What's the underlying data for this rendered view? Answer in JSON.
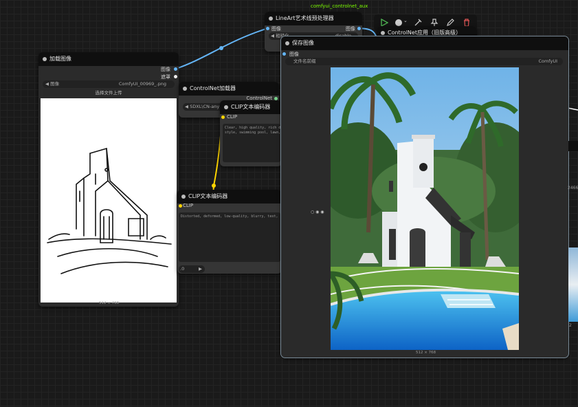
{
  "group_title": "comfyui_controlnet_aux",
  "toolbar": {
    "icons": [
      "play-icon",
      "circle-dropdown-icon",
      "eyedropper-icon",
      "pin-icon",
      "pencil-icon",
      "trash-icon"
    ]
  },
  "colors": {
    "image_wire": "#64b5f6",
    "clip_wire": "#ffd500",
    "accent_green": "#7CFC00",
    "trash_red": "#e05555"
  },
  "load_image": {
    "title": "加载图像",
    "out_image": "图像",
    "out_mask": "遮罩",
    "image_label": "图像",
    "image_value": "ComfyUI_00969_.png",
    "upload_label": "选择文件上传",
    "size": "512 × 768"
  },
  "lineart": {
    "title": "LineArt艺术线预处理器",
    "in_image": "图像",
    "out_image": "图像",
    "widget1_label": "粗糙化",
    "widget1_value": "disable"
  },
  "controlnet_apply": {
    "title": "ControlNet应用（旧版高级）"
  },
  "controlnet_loader": {
    "title": "ControlNet加载器",
    "out": "ControlNet",
    "model_value": "SDXL\\CN-any"
  },
  "clip_top": {
    "title": "CLIP文本编码器",
    "in_clip": "CLIP",
    "text": "Clear, high quality, rich deta\nstyle, swimming pool, lawn, re"
  },
  "clip_bottom": {
    "title": "CLIP文本编码器",
    "in_clip": "CLIP",
    "text": "Distorted, deformed, low-quality, blurry, text, flower",
    "widget_value": ".0"
  },
  "save_image": {
    "title": "保存图像",
    "in_image": "图像",
    "prefix_label": "文件名前缀",
    "prefix_value": "ComfyUI",
    "size": "512 × 768"
  },
  "right_edge": {
    "text1": "2466",
    "text2": "2"
  }
}
